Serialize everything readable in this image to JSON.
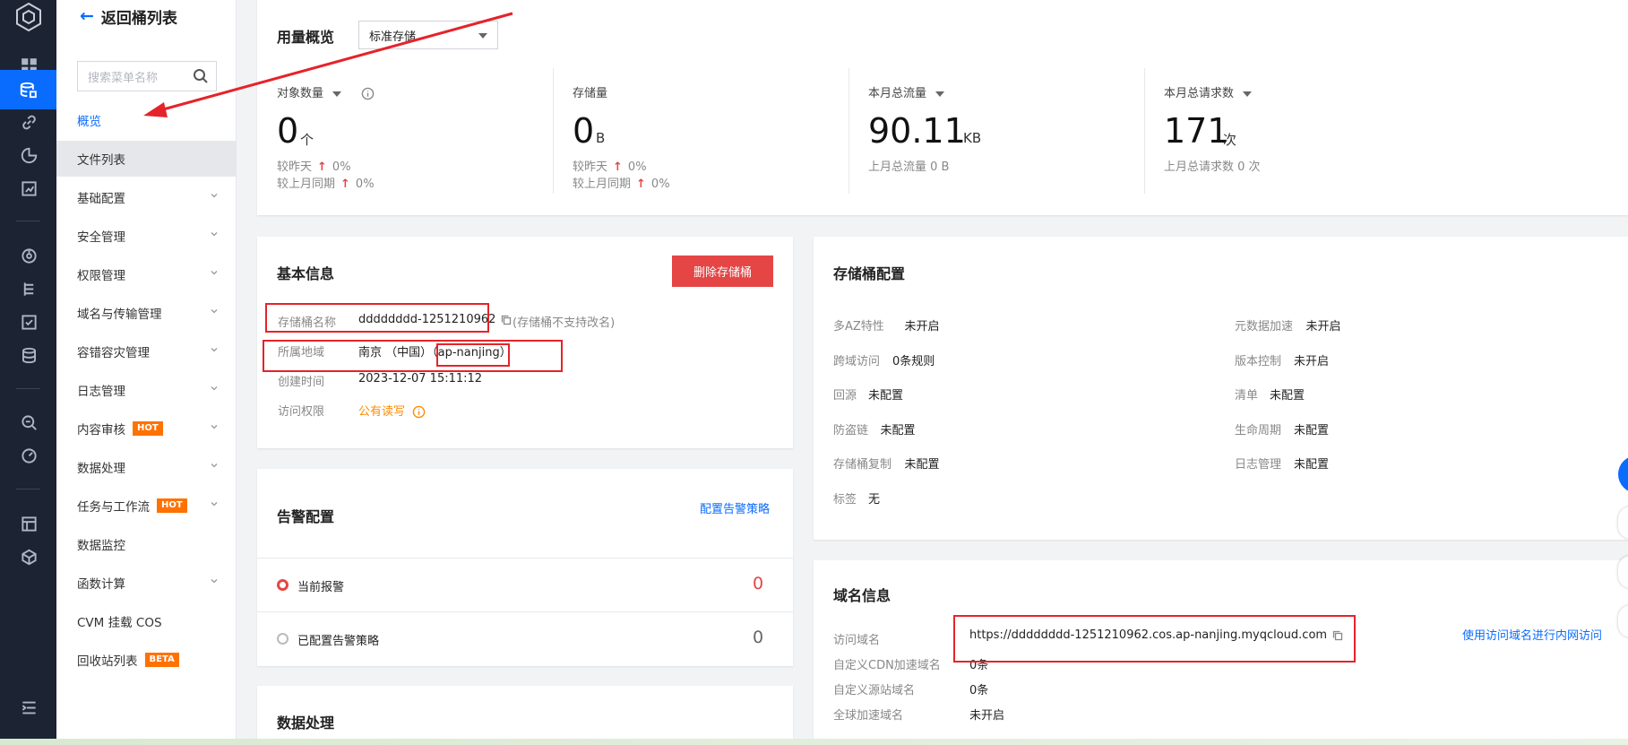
{
  "colors": {
    "accent": "#0a6cff",
    "danger": "#e54545",
    "hot": "#ff7200",
    "annotation": "#e5232a"
  },
  "rail": {
    "icons": [
      "logo-cube-icon",
      "dashboard-icon",
      "bucket-icon",
      "link-icon",
      "pie-chart-icon",
      "report-icon",
      "scan-icon",
      "tree-icon",
      "checklist-icon",
      "database-icon",
      "search-doc-icon",
      "gauge-icon",
      "storage-icon",
      "cube-icon",
      "menu-collapse-icon"
    ]
  },
  "sidebar": {
    "back_label": "返回桶列表",
    "search_placeholder": "搜索菜单名称",
    "items": [
      {
        "label": "概览",
        "state": "active"
      },
      {
        "label": "文件列表",
        "state": "selected"
      },
      {
        "label": "基础配置",
        "expandable": true
      },
      {
        "label": "安全管理",
        "expandable": true
      },
      {
        "label": "权限管理",
        "expandable": true
      },
      {
        "label": "域名与传输管理",
        "expandable": true
      },
      {
        "label": "容错容灾管理",
        "expandable": true
      },
      {
        "label": "日志管理",
        "expandable": true
      },
      {
        "label": "内容审核",
        "badge": "HOT",
        "expandable": true
      },
      {
        "label": "数据处理",
        "expandable": true
      },
      {
        "label": "任务与工作流",
        "badge": "HOT",
        "expandable": true
      },
      {
        "label": "数据监控"
      },
      {
        "label": "函数计算",
        "expandable": true
      },
      {
        "label": "CVM 挂载 COS"
      },
      {
        "label": "回收站列表",
        "badge": "BETA"
      }
    ]
  },
  "usage": {
    "title": "用量概览",
    "storage_class": "标准存储",
    "stats": [
      {
        "label": "对象数量",
        "value": "0",
        "unit": "个",
        "line1": "较昨天",
        "line1_val": "0%",
        "line2": "较上月同期",
        "line2_val": "0%"
      },
      {
        "label": "存储量",
        "value": "0",
        "unit": "B",
        "line1": "较昨天",
        "line1_val": "0%",
        "line2": "较上月同期",
        "line2_val": "0%"
      },
      {
        "label": "本月总流量",
        "value": "90.11",
        "unit": "KB",
        "sub": "上月总流量 0 B"
      },
      {
        "label": "本月总请求数",
        "value": "171",
        "unit": "次",
        "sub": "上月总请求数 0 次"
      }
    ],
    "up_arrow": "↑"
  },
  "basic": {
    "title": "基本信息",
    "delete_button": "删除存储桶",
    "name_label": "存储桶名称",
    "name_value": "dddddddd-1251210962",
    "name_note": "(存储桶不支持改名)",
    "region_label": "所属地域",
    "region_value": "南京 （中国）（ap-nanjing）",
    "created_label": "创建时间",
    "created_value": "2023-12-07 15:11:12",
    "access_label": "访问权限",
    "access_value": "公有读写"
  },
  "bucket_config": {
    "title": "存储桶配置",
    "left": [
      {
        "label": "多AZ特性",
        "value": "未开启"
      },
      {
        "label": "跨域访问",
        "value": "0条规则"
      },
      {
        "label": "回源",
        "value": "未配置"
      },
      {
        "label": "防盗链",
        "value": "未配置"
      },
      {
        "label": "存储桶复制",
        "value": "未配置"
      },
      {
        "label": "标签",
        "value": "无"
      }
    ],
    "right": [
      {
        "label": "元数据加速",
        "value": "未开启"
      },
      {
        "label": "版本控制",
        "value": "未开启"
      },
      {
        "label": "清单",
        "value": "未配置"
      },
      {
        "label": "生命周期",
        "value": "未配置"
      },
      {
        "label": "日志管理",
        "value": "未配置"
      }
    ]
  },
  "alarm": {
    "title": "告警配置",
    "config_link": "配置告警策略",
    "current_label": "当前报警",
    "current_value": "0",
    "configured_label": "已配置告警策略",
    "configured_value": "0"
  },
  "domain": {
    "title": "域名信息",
    "rows": [
      {
        "label": "访问域名",
        "value": "https://dddddddd-1251210962.cos.ap-nanjing.myqcloud.com"
      },
      {
        "label": "自定义CDN加速域名",
        "value": "0条"
      },
      {
        "label": "自定义源站域名",
        "value": "0条"
      },
      {
        "label": "全球加速域名",
        "value": "未开启"
      }
    ],
    "intranet_link": "使用访问域名进行内网访问"
  },
  "data_processing": {
    "title": "数据处理"
  }
}
